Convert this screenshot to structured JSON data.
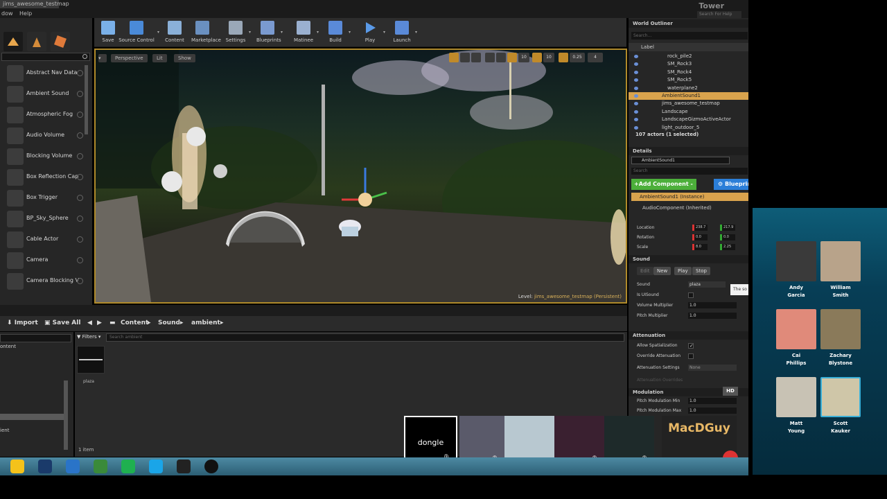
{
  "title_bar": {
    "tab": "jims_awesome_testmap",
    "menus": [
      "dow",
      "Help"
    ],
    "app_title": "Tower",
    "help_search_placeholder": "Search For Help"
  },
  "modes": {
    "items": [
      {
        "label": "Abstract Nav Data"
      },
      {
        "label": "Ambient Sound"
      },
      {
        "label": "Atmospheric Fog"
      },
      {
        "label": "Audio Volume"
      },
      {
        "label": "Blocking Volume"
      },
      {
        "label": "Box Reflection Cap"
      },
      {
        "label": "Box Trigger"
      },
      {
        "label": "BP_Sky_Sphere"
      },
      {
        "label": "Cable Actor"
      },
      {
        "label": "Camera"
      },
      {
        "label": "Camera Blocking V"
      }
    ]
  },
  "toolbar": {
    "buttons": [
      {
        "label": "Save",
        "icon": "save-icon"
      },
      {
        "label": "Source Control",
        "icon": "source-control-icon"
      },
      {
        "label": "Content",
        "icon": "content-icon"
      },
      {
        "label": "Marketplace",
        "icon": "marketplace-icon"
      },
      {
        "label": "Settings",
        "icon": "settings-icon"
      },
      {
        "label": "Blueprints",
        "icon": "blueprints-icon"
      },
      {
        "label": "Matinee",
        "icon": "matinee-icon"
      },
      {
        "label": "Build",
        "icon": "build-icon"
      },
      {
        "label": "Play",
        "icon": "play-icon"
      },
      {
        "label": "Launch",
        "icon": "launch-icon"
      }
    ]
  },
  "viewport": {
    "perspective": "Perspective",
    "lit": "Lit",
    "show": "Show",
    "snap_angle": "10",
    "grid_size": "10",
    "scale_snap": "0.25",
    "cams": "4",
    "level_label": "Level:",
    "level_name": "jims_awesome_testmap (Persistent)"
  },
  "content_browser": {
    "import": "Import",
    "save_all": "Save All",
    "path": [
      "Content",
      "Sound",
      "ambient"
    ],
    "filters": "Filters",
    "search_placeholder": "Search ambient",
    "asset_name": "plaza",
    "item_count": "1 item",
    "tree_rows": [
      "ontent",
      "ient"
    ]
  },
  "outliner": {
    "title": "World Outliner",
    "search_placeholder": "Search...",
    "label_col": "Label",
    "rows": [
      {
        "label": "rock_pile2",
        "indent": 2
      },
      {
        "label": "SM_Rock3",
        "indent": 2
      },
      {
        "label": "SM_Rock4",
        "indent": 2
      },
      {
        "label": "SM_Rock5",
        "indent": 2
      },
      {
        "label": "waterplane2",
        "indent": 2
      },
      {
        "label": "AmbientSound1",
        "indent": 1,
        "selected": true
      },
      {
        "label": "jims_awesome_testmap",
        "indent": 1
      },
      {
        "label": "Landscape",
        "indent": 1
      },
      {
        "label": "LandscapeGizmoActiveActor",
        "indent": 1
      },
      {
        "label": "light_outdoor_5",
        "indent": 1
      }
    ],
    "actor_count": "107 actors (1 selected)"
  },
  "details": {
    "title": "Details",
    "name": "AmbientSound1",
    "search_placeholder": "Search",
    "add_component": "+Add Component -",
    "blueprint": "Blueprint",
    "instance": "AmbientSound1 (Instance)",
    "component": "AudioComponent (Inherited)",
    "transform": {
      "location_label": "Location",
      "rotation_label": "Rotation",
      "scale_label": "Scale",
      "location": [
        "238.7",
        "217.9"
      ],
      "rotation": [
        "0.0",
        "0.0"
      ],
      "scale": [
        "8.0",
        "2.25"
      ]
    },
    "sound_section": "Sound",
    "sound_buttons": [
      "Edit",
      "New",
      "Play",
      "Stop"
    ],
    "sound_props": [
      {
        "label": "Sound",
        "value": "plaza"
      },
      {
        "label": "Is UISound",
        "value": ""
      },
      {
        "label": "Volume Multiplier",
        "value": "1.0"
      },
      {
        "label": "Pitch Multiplier",
        "value": "1.0"
      }
    ],
    "tooltip": "The so",
    "attenuation_section": "Attenuation",
    "attenuation_props": [
      {
        "label": "Allow Spatialization",
        "checked": true
      },
      {
        "label": "Override Attenuation",
        "checked": false
      }
    ],
    "attenuation_settings_label": "Attenuation Settings",
    "attenuation_settings_value": "None",
    "attenuation_overrides": "Attenuation Overrides",
    "modulation_section": "Modulation",
    "hd_badge": "HD",
    "modulation_props": [
      {
        "label": "Pitch Modulation Min",
        "value": "1.0"
      },
      {
        "label": "Pitch Modulation Max",
        "value": "1.0"
      }
    ]
  },
  "call": {
    "participants": [
      {
        "name": "Andy Garcia",
        "line1": "Andy",
        "line2": "Garcia",
        "color": "#3a3a3a"
      },
      {
        "name": "William Smith",
        "line1": "William",
        "line2": "Smith",
        "color": "#b8a38a"
      },
      {
        "name": "Cai Phillips",
        "line1": "Cai",
        "line2": "Phillips",
        "color": "#e08a7a"
      },
      {
        "name": "Zachary Blystone",
        "line1": "Zachary",
        "line2": "Blystone",
        "color": "#8a7a5a"
      },
      {
        "name": "Matt Young",
        "line1": "Matt",
        "line2": "Young",
        "color": "#c8c2b4"
      },
      {
        "name": "Scott Kaulker",
        "line1": "Scott",
        "line2": "Kauker",
        "color": "#cfc6a8"
      }
    ],
    "dongle": "dongle",
    "macdguy": "MacDGuy"
  }
}
